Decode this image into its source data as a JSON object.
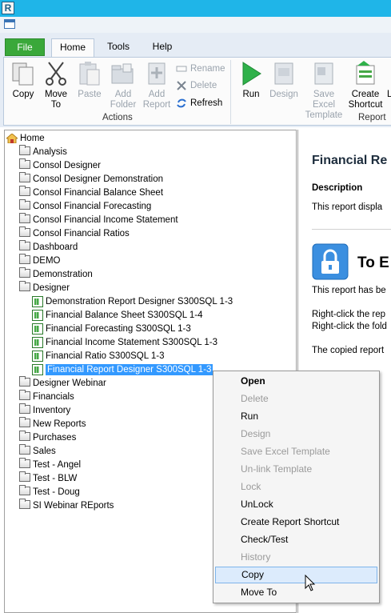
{
  "ribbon": {
    "tabs": [
      "File",
      "Home",
      "Tools",
      "Help"
    ],
    "actions": {
      "copy": "Copy",
      "move_to": "Move To",
      "paste": "Paste",
      "add_folder": "Add Folder",
      "add_report": "Add Report",
      "rename": "Rename",
      "delete": "Delete",
      "refresh": "Refresh",
      "group_label": "Actions"
    },
    "report": {
      "run": "Run",
      "design": "Design",
      "save_excel_template": "Save Excel Template",
      "create_shortcut": "Create Shortcut",
      "group_label": "Report"
    }
  },
  "tree": {
    "root": "Home",
    "folders_before": [
      "Analysis",
      "Consol Designer",
      "Consol Designer Demonstration",
      "Consol Financial Balance Sheet",
      "Consol Financial Forecasting",
      "Consol Financial Income Statement",
      "Consol Financial Ratios",
      "Dashboard",
      "DEMO",
      "Demonstration",
      "Designer"
    ],
    "designer_reports": [
      "Demonstration Report Designer S300SQL 1-3",
      "Financial Balance Sheet S300SQL 1-4",
      "Financial Forecasting S300SQL 1-3",
      "Financial Income Statement S300SQL 1-3",
      "Financial Ratio S300SQL 1-3",
      "Financial Report Designer S300SQL 1-3"
    ],
    "selected_report": "Financial Report Designer S300SQL 1-3",
    "folders_after": [
      "Designer Webinar",
      "Financials",
      "Inventory",
      "New Reports",
      "Purchases",
      "Sales",
      "Test - Angel",
      "Test - BLW",
      "Test - Doug",
      "SI Webinar REports"
    ]
  },
  "detail": {
    "title": "Financial Re",
    "description_heading": "Description",
    "description_text": "This report displa",
    "lock_heading": "To E",
    "lock_text": "This report has be",
    "hint1": "Right-click the rep",
    "hint2": "Right-click the fold",
    "copied_text": "The copied report"
  },
  "context_menu": {
    "items": [
      {
        "label": "Open",
        "state": "bold"
      },
      {
        "label": "Delete",
        "state": "disabled"
      },
      {
        "label": "Run",
        "state": "enabled"
      },
      {
        "label": "Design",
        "state": "disabled"
      },
      {
        "label": "Save Excel Template",
        "state": "disabled"
      },
      {
        "label": "Un-link Template",
        "state": "disabled"
      },
      {
        "label": "Lock",
        "state": "disabled"
      },
      {
        "label": "UnLock",
        "state": "enabled"
      },
      {
        "label": "Create Report Shortcut",
        "state": "enabled"
      },
      {
        "label": "Check/Test",
        "state": "enabled"
      },
      {
        "label": "History",
        "state": "disabled"
      },
      {
        "label": "Copy",
        "state": "hover"
      },
      {
        "label": "Move To",
        "state": "enabled"
      }
    ]
  },
  "colors": {
    "titlebar": "#1fb5e8",
    "file_tab": "#3aa83a",
    "selection": "#3399ff",
    "menu_hover": "#dcebfc"
  }
}
